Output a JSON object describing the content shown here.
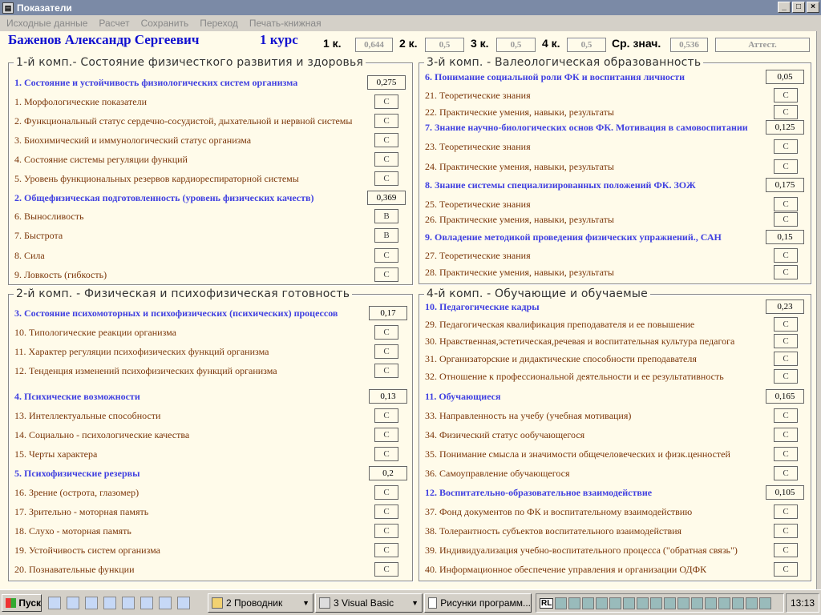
{
  "window": {
    "title": "Показатели",
    "minimize": "_",
    "maximize": "□",
    "close": "×"
  },
  "menu": [
    "Исходные данные",
    "Расчет",
    "Сохранить",
    "Переход",
    "Печать-книжная"
  ],
  "header": {
    "student": "Баженов Александр Сергеевич",
    "course": "1 курс",
    "scores": [
      {
        "label": "1 к.",
        "value": "0,644"
      },
      {
        "label": "2 к.",
        "value": "0,5"
      },
      {
        "label": "3 к.",
        "value": "0,5"
      },
      {
        "label": "4 к.",
        "value": "0,5"
      },
      {
        "label": "Ср. знач.",
        "value": "0,536"
      }
    ],
    "attest": "Аттест."
  },
  "panels": [
    {
      "title": "1-й комп.- Состояние физичесткого развития и здоровья",
      "rows": [
        {
          "text": "1. Состояние и устойчивость физиологических систем организма",
          "value": "0,275",
          "head": true
        },
        {
          "text": "1. Морфологические показатели",
          "value": "С"
        },
        {
          "text": "2. Функциональный статус сердечно-сосудистой, дыхательной и нервной системы",
          "value": "С"
        },
        {
          "text": "3. Биохимический и иммунологический статус организма",
          "value": "С"
        },
        {
          "text": "4. Состояние системы регуляции функций",
          "value": "С"
        },
        {
          "text": "5. Уровень функциональных резервов кардиореспираторной системы",
          "value": "С"
        },
        {
          "text": "2. Общефизическая подготовленность (уровень физических качеств)",
          "value": "0,369",
          "head": true
        },
        {
          "text": "6. Выносливость",
          "value": "В"
        },
        {
          "text": "7. Быстрота",
          "value": "В"
        },
        {
          "text": "8. Сила",
          "value": "С"
        },
        {
          "text": "9. Ловкость (гибкость)",
          "value": "С"
        }
      ]
    },
    {
      "title": "2-й комп. - Физическая и психофизическая готовность",
      "rows": [
        {
          "text": "3. Состояние психомоторных и психофизических (психических) процессов",
          "value": "0,17",
          "head": true
        },
        {
          "text": "10. Типологические реакции организма",
          "value": "С"
        },
        {
          "text": "11. Характер регуляции психофизических функций организма",
          "value": "С"
        },
        {
          "text": "12. Тенденция изменений психофизических функций организма",
          "value": "С"
        },
        {
          "text": "4. Психические возможности",
          "value": "0,13",
          "head": true
        },
        {
          "text": "13. Интеллектуальные способности",
          "value": "С"
        },
        {
          "text": "14. Социально - психологические качества",
          "value": "С"
        },
        {
          "text": "15. Черты характера",
          "value": "С"
        },
        {
          "text": "5. Психофизические резервы",
          "value": "0,2",
          "head": true
        },
        {
          "text": "16. Зрение (острота, глазомер)",
          "value": "С"
        },
        {
          "text": "17. Зрительно - моторная память",
          "value": "С"
        },
        {
          "text": "18. Слухо - моторная память",
          "value": "С"
        },
        {
          "text": "19. Устойчивость систем организма",
          "value": "С"
        },
        {
          "text": "20. Познавательные функции",
          "value": "С"
        }
      ]
    },
    {
      "title": "3-й комп. - Валеологическая образованность",
      "rows": [
        {
          "text": "6. Понимание социальной роли ФК и воспитания личности",
          "value": "0,05",
          "head": true
        },
        {
          "text": "21. Теоретические знания",
          "value": "С"
        },
        {
          "text": "22. Практические умения, навыки, результаты",
          "value": "С"
        },
        {
          "text": "7. Знание научно-биологических основ ФК. Мотивация в самовоспитании",
          "value": "0,125",
          "head": true
        },
        {
          "text": "23. Теоретические знания",
          "value": "С"
        },
        {
          "text": "24. Практические умения, навыки, результаты",
          "value": "С"
        },
        {
          "text": "8. Знание системы специализированных положений ФК. ЗОЖ",
          "value": "0,175",
          "head": true
        },
        {
          "text": "25. Теоретические знания",
          "value": "С"
        },
        {
          "text": "26. Практические умения, навыки, результаты",
          "value": "С"
        },
        {
          "text": "9. Овладение методикой проведения физических упражнений., САН",
          "value": "0,15",
          "head": true
        },
        {
          "text": "27. Теоретические знания",
          "value": "С"
        },
        {
          "text": "28. Практические умения, навыки, результаты",
          "value": "С"
        }
      ]
    },
    {
      "title": "4-й комп. - Обучающие и обучаемые",
      "rows": [
        {
          "text": "10. Педагогические кадры",
          "value": "0,23",
          "head": true
        },
        {
          "text": "29. Педагогическая квалификация преподавателя и ее повышение",
          "value": "С"
        },
        {
          "text": "30. Нравственная,эстетическая,речевая и воспитательная культура педагога",
          "value": "С"
        },
        {
          "text": "31. Организаторские и дидактические способности преподавателя",
          "value": "С"
        },
        {
          "text": "32. Отношение к профессиональной деятельности и ее результативность",
          "value": "С"
        },
        {
          "text": "11. Обучающиеся",
          "value": "0,165",
          "head": true
        },
        {
          "text": "33. Направленность на учебу (учебная мотивация)",
          "value": "С"
        },
        {
          "text": "34. Физический статус ообучающегося",
          "value": "С"
        },
        {
          "text": "35. Понимание смысла и значимости общечеловеческих и физк.ценностей",
          "value": "С"
        },
        {
          "text": "36. Самоуправление обучающегося",
          "value": "С"
        },
        {
          "text": "12. Воспитательно-образовательное взаимодействие",
          "value": "0,105",
          "head": true
        },
        {
          "text": "37. Фонд документов по ФК и воспитательному взаимодействию",
          "value": "С"
        },
        {
          "text": "38. Толерантность субъектов воспитательного взаимодействия",
          "value": "С"
        },
        {
          "text": "39. Индивидуализация учебно-воспитательного процесса (\"обратная связь\")",
          "value": "С"
        },
        {
          "text": "40. Информационное обеспечение управления и организации ОДФК",
          "value": "С"
        }
      ]
    }
  ],
  "taskbar": {
    "start": "Пуск",
    "tasks": [
      {
        "label": "2 Проводник"
      },
      {
        "label": "3 Visual Basic"
      },
      {
        "label": "Рисунки программ..."
      }
    ],
    "tray_lang": "RL",
    "clock": "13:13"
  }
}
